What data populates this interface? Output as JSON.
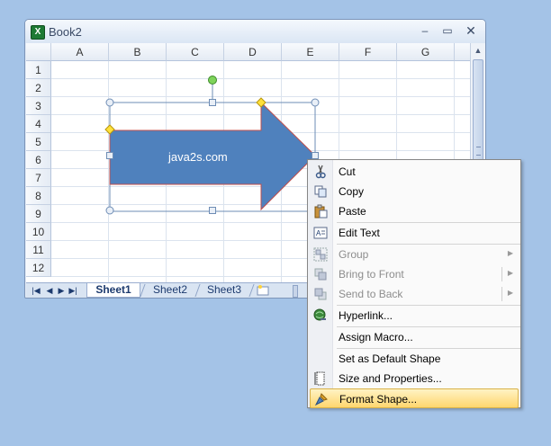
{
  "window": {
    "title": "Book2",
    "minimize": "–",
    "maximize": "▭",
    "close": "✕"
  },
  "columns": [
    "A",
    "B",
    "C",
    "D",
    "E",
    "F",
    "G"
  ],
  "rows": [
    "1",
    "2",
    "3",
    "4",
    "5",
    "6",
    "7",
    "8",
    "9",
    "10",
    "11",
    "12"
  ],
  "shape": {
    "text": "java2s.com",
    "fill": "#4f81bd",
    "outline": "#c0504d"
  },
  "sheets": {
    "tabs": [
      "Sheet1",
      "Sheet2",
      "Sheet3"
    ],
    "active": "Sheet1"
  },
  "context_menu": {
    "items": [
      {
        "label": "Cut",
        "icon": "scissors-icon",
        "enabled": true
      },
      {
        "label": "Copy",
        "icon": "copy-icon",
        "enabled": true
      },
      {
        "label": "Paste",
        "icon": "paste-icon",
        "enabled": true
      },
      {
        "label": "Edit Text",
        "icon": "edit-text-icon",
        "enabled": true
      },
      {
        "label": "Group",
        "icon": "group-icon",
        "enabled": false,
        "submenu": true
      },
      {
        "label": "Bring to Front",
        "icon": "bring-to-front-icon",
        "enabled": false,
        "submenu": true
      },
      {
        "label": "Send to Back",
        "icon": "send-to-back-icon",
        "enabled": false,
        "submenu": true
      },
      {
        "label": "Hyperlink...",
        "icon": "hyperlink-icon",
        "enabled": true
      },
      {
        "label": "Assign Macro...",
        "icon": "",
        "enabled": true
      },
      {
        "label": "Set as Default Shape",
        "icon": "",
        "enabled": true
      },
      {
        "label": "Size and Properties...",
        "icon": "size-properties-icon",
        "enabled": true
      },
      {
        "label": "Format Shape...",
        "icon": "format-shape-icon",
        "enabled": true,
        "highlighted": true
      }
    ]
  },
  "colors": {
    "desktop": "#a4c3e7",
    "menu_highlight": "#ffd66e"
  }
}
